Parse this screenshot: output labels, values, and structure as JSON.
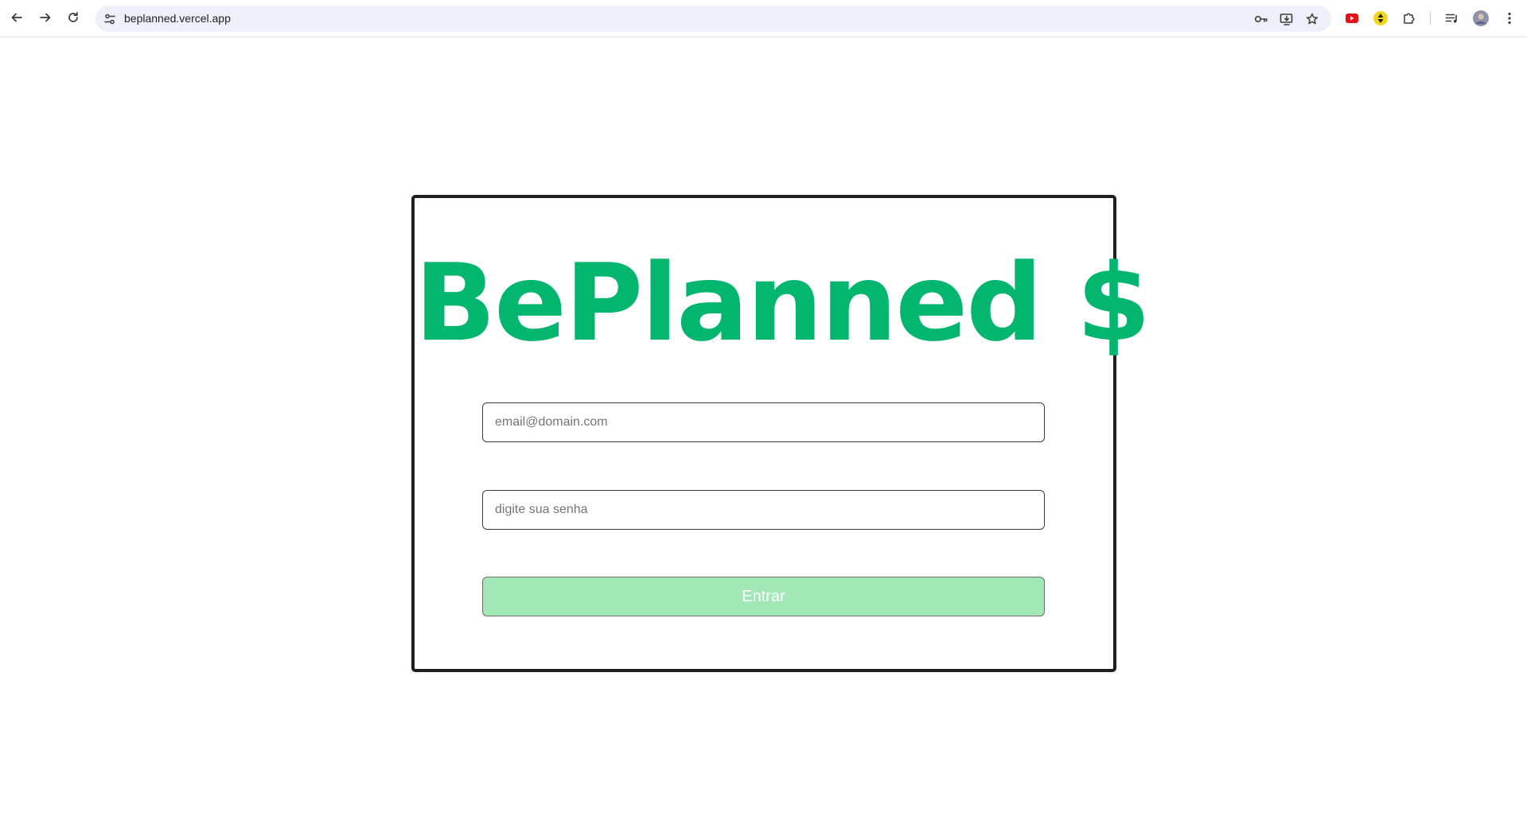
{
  "browser": {
    "url": "beplanned.vercel.app",
    "icons": {
      "back": "back-arrow-icon",
      "forward": "forward-arrow-icon",
      "reload": "reload-icon",
      "site_info": "tune-icon",
      "password": "key-icon",
      "install": "install-app-icon",
      "bookmark": "star-icon",
      "extension_red": "youtube-extension-icon",
      "extension_yellow": "yellow-extension-icon",
      "extensions": "puzzle-icon",
      "media": "media-controls-icon",
      "profile": "avatar",
      "menu": "kebab-menu-icon"
    }
  },
  "login": {
    "brand": "BePlanned $",
    "email_placeholder": "email@domain.com",
    "password_placeholder": "digite sua senha",
    "submit_label": "Entrar"
  },
  "colors": {
    "brand_green": "#02b66f",
    "button_green": "#a2e8b6",
    "card_border": "#1f1f1f"
  }
}
